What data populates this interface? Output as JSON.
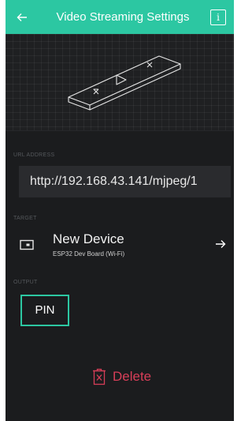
{
  "header": {
    "title": "Video Streaming Settings",
    "back_icon": "arrow-left-icon",
    "info_icon": "info-icon",
    "info_glyph": "i"
  },
  "sections": {
    "url_label": "URL ADDRESS",
    "target_label": "TARGET",
    "output_label": "OUTPUT"
  },
  "url": {
    "value": "http://192.168.43.141/mjpeg/1"
  },
  "target": {
    "device_name": "New Device",
    "board": "ESP32 Dev Board (Wi-Fi)",
    "device_icon": "device-icon",
    "arrow_icon": "arrow-right-icon"
  },
  "output": {
    "pin_label": "PIN"
  },
  "actions": {
    "delete_label": "Delete",
    "delete_icon": "trash-icon"
  },
  "colors": {
    "accent": "#2cc7a2",
    "background": "#1b1c1e",
    "danger": "#d73e58"
  }
}
